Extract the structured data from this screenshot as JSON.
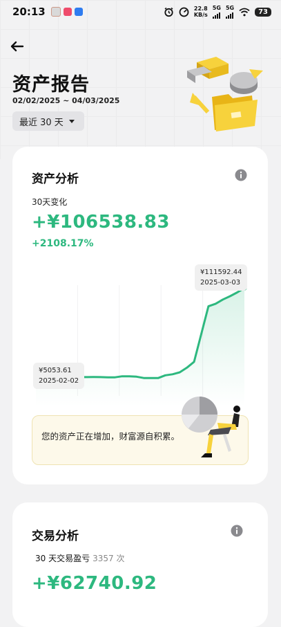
{
  "status_bar": {
    "time": "20:13",
    "net_speed_value": "22.8",
    "net_speed_unit": "KB/s",
    "sig1": "5G",
    "sig2": "5G",
    "battery": "73"
  },
  "header": {
    "title": "资产报告",
    "date_range": "02/02/2025 ~ 04/03/2025",
    "period_label": "最近 30 天"
  },
  "asset_card": {
    "title": "资产分析",
    "change_label": "30天变化",
    "change_value": "+¥106538.83",
    "change_percent": "+2108.17%",
    "start_amount": "¥5053.61",
    "start_date": "2025-02-02",
    "end_amount": "¥111592.44",
    "end_date": "2025-03-03",
    "banner_text": "您的资产正在增加，财富源自积累。",
    "line_color": "#2db87f"
  },
  "trade_card": {
    "title": "交易分析",
    "pnl_label": "30 天交易盈亏",
    "trade_count": "3357 次",
    "pnl_value": "+¥62740.92"
  },
  "chart_data": {
    "type": "line",
    "x": [
      "2025-02-02",
      "2025-02-03",
      "2025-02-04",
      "2025-02-05",
      "2025-02-06",
      "2025-02-07",
      "2025-02-08",
      "2025-02-09",
      "2025-02-10",
      "2025-02-11",
      "2025-02-12",
      "2025-02-13",
      "2025-02-14",
      "2025-02-15",
      "2025-02-16",
      "2025-02-17",
      "2025-02-18",
      "2025-02-19",
      "2025-02-20",
      "2025-02-21",
      "2025-02-22",
      "2025-02-23",
      "2025-02-24",
      "2025-02-25",
      "2025-02-26",
      "2025-02-27",
      "2025-02-28",
      "2025-03-01",
      "2025-03-02",
      "2025-03-03"
    ],
    "values": [
      5053.61,
      6200,
      6100,
      5900,
      5950,
      5900,
      5850,
      5800,
      5900,
      5800,
      5600,
      5600,
      6800,
      6800,
      6300,
      4800,
      4700,
      4700,
      8000,
      9200,
      11500,
      17000,
      24000,
      57000,
      90000,
      93000,
      98000,
      102000,
      106500,
      111592.44
    ],
    "ylim": [
      0,
      125000
    ],
    "annotations": [
      {
        "x": "2025-02-02",
        "label": "¥5053.61"
      },
      {
        "x": "2025-03-03",
        "label": "¥111592.44"
      }
    ]
  }
}
